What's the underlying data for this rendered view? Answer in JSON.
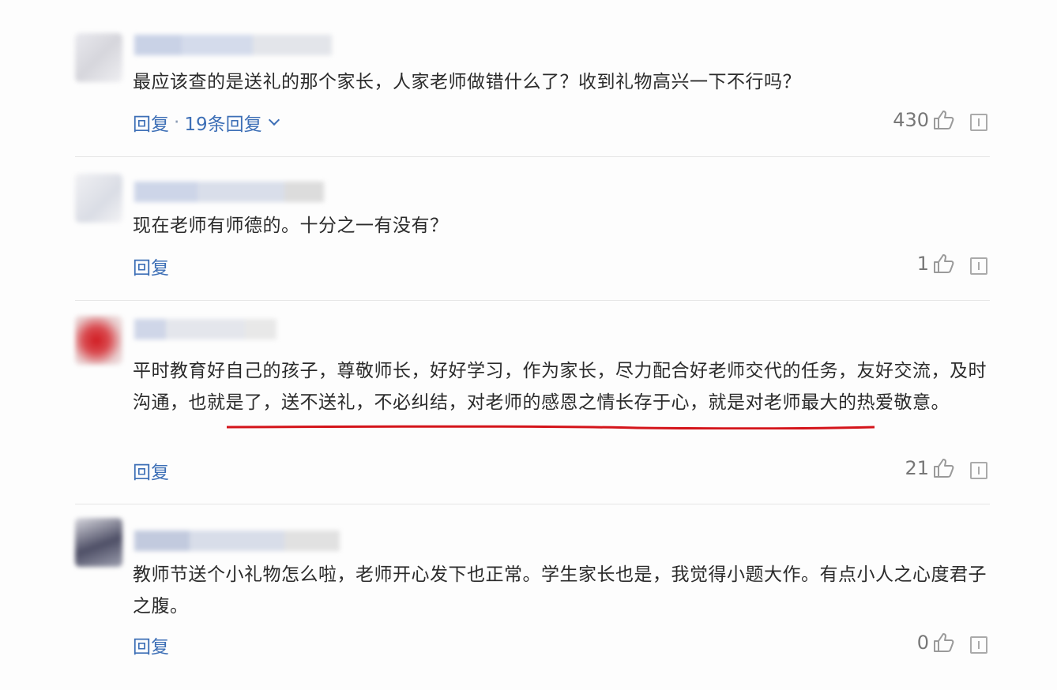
{
  "comments": [
    {
      "text": "最应该查的是送礼的那个家长，人家老师做错什么了？收到礼物高兴一下不行吗？",
      "reply_label": "回复",
      "separator": "·",
      "replies_label": "19条回复",
      "likes": "430"
    },
    {
      "text": "现在老师有师德的。十分之一有没有？",
      "reply_label": "回复",
      "likes": "1"
    },
    {
      "text": "平时教育好自己的孩子，尊敬师长，好好学习，作为家长，尽力配合好老师交代的任务，友好交流，及时沟通，也就是了，送不送礼，不必纠结，对老师的感恩之情长存于心，就是对老师最大的热爱敬意。",
      "reply_label": "回复",
      "likes": "21"
    },
    {
      "text": "教师节送个小礼物怎么啦，老师开心发下也正常。学生家长也是，我觉得小题大作。有点小人之心度君子之腹。",
      "reply_label": "回复",
      "likes": "0"
    }
  ],
  "icons": {
    "like": "thumbs-up-icon",
    "report": "report-icon",
    "expand": "chevron-down-icon"
  },
  "colors": {
    "link": "#3d6fb6",
    "text": "#2b2b2b",
    "underline": "#d4141a"
  }
}
